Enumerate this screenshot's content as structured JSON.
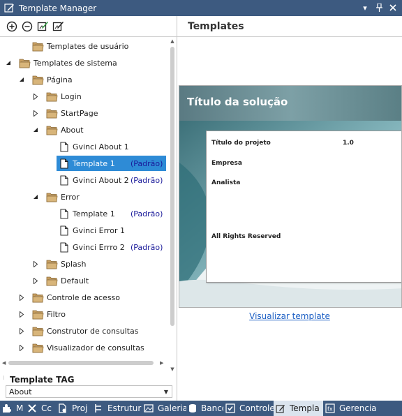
{
  "window": {
    "title": "Template Manager"
  },
  "tree": {
    "items": [
      {
        "label": "Templates de usuário",
        "level": 1,
        "kind": "folder",
        "expander": "none"
      },
      {
        "label": "Templates de sistema",
        "level": 0,
        "kind": "folder",
        "expander": "expanded"
      },
      {
        "label": "Página",
        "level": 1,
        "kind": "folder",
        "expander": "expanded"
      },
      {
        "label": "Login",
        "level": 2,
        "kind": "folder",
        "expander": "collapsed"
      },
      {
        "label": "StartPage",
        "level": 2,
        "kind": "folder",
        "expander": "collapsed"
      },
      {
        "label": "About",
        "level": 2,
        "kind": "folder",
        "expander": "expanded"
      },
      {
        "label": "Gvinci About 1",
        "level": 3,
        "kind": "file",
        "expander": "none"
      },
      {
        "label": "Template 1",
        "level": 3,
        "kind": "file",
        "expander": "none",
        "tag": "(Padrão)",
        "selected": true
      },
      {
        "label": "Gvinci About 2",
        "level": 3,
        "kind": "file",
        "expander": "none",
        "tag": "(Padrão)"
      },
      {
        "label": "Error",
        "level": 2,
        "kind": "folder",
        "expander": "expanded"
      },
      {
        "label": "Template 1",
        "level": 3,
        "kind": "file",
        "expander": "none",
        "tag": "(Padrão)"
      },
      {
        "label": "Gvinci Error 1",
        "level": 3,
        "kind": "file",
        "expander": "none"
      },
      {
        "label": "Gvinci Errro 2",
        "level": 3,
        "kind": "file",
        "expander": "none",
        "tag": "(Padrão)"
      },
      {
        "label": "Splash",
        "level": 2,
        "kind": "folder",
        "expander": "collapsed"
      },
      {
        "label": "Default",
        "level": 2,
        "kind": "folder",
        "expander": "collapsed"
      },
      {
        "label": "Controle de acesso",
        "level": 1,
        "kind": "folder",
        "expander": "collapsed"
      },
      {
        "label": "Filtro",
        "level": 1,
        "kind": "folder",
        "expander": "collapsed"
      },
      {
        "label": "Construtor de consultas",
        "level": 1,
        "kind": "folder",
        "expander": "collapsed"
      },
      {
        "label": "Visualizador de consultas",
        "level": 1,
        "kind": "folder",
        "expander": "collapsed"
      }
    ]
  },
  "template_tag": {
    "title": "Template TAG",
    "selected": "About"
  },
  "right_panel": {
    "title": "Templates",
    "preview": {
      "banner_title": "Título da solução",
      "fields": {
        "project_label": "Título do projeto",
        "project_value": "1.0",
        "company_label": "Empresa",
        "analyst_label": "Analista",
        "rights_label": "All Rights Reserved"
      }
    },
    "link": "Visualizar template"
  },
  "bottom_tabs": [
    {
      "label": "M",
      "icon": "puzzle-icon"
    },
    {
      "label": "Cc",
      "icon": "tools-icon"
    },
    {
      "label": "Proj",
      "icon": "document-gear-icon"
    },
    {
      "label": "Estrutura",
      "icon": "structure-icon"
    },
    {
      "label": "Galeria",
      "icon": "image-icon"
    },
    {
      "label": "Banco",
      "icon": "database-icon"
    },
    {
      "label": "Controles",
      "icon": "controls-icon"
    },
    {
      "label": "Templa",
      "icon": "template-icon",
      "active": true
    },
    {
      "label": "Gerencia",
      "icon": "fx-icon"
    }
  ],
  "colors": {
    "titlebar": "#3d5a80",
    "selection": "#2e8bd6",
    "folder": "#c9a063",
    "link": "#1c5fc4",
    "tag": "#1a1a9a"
  }
}
